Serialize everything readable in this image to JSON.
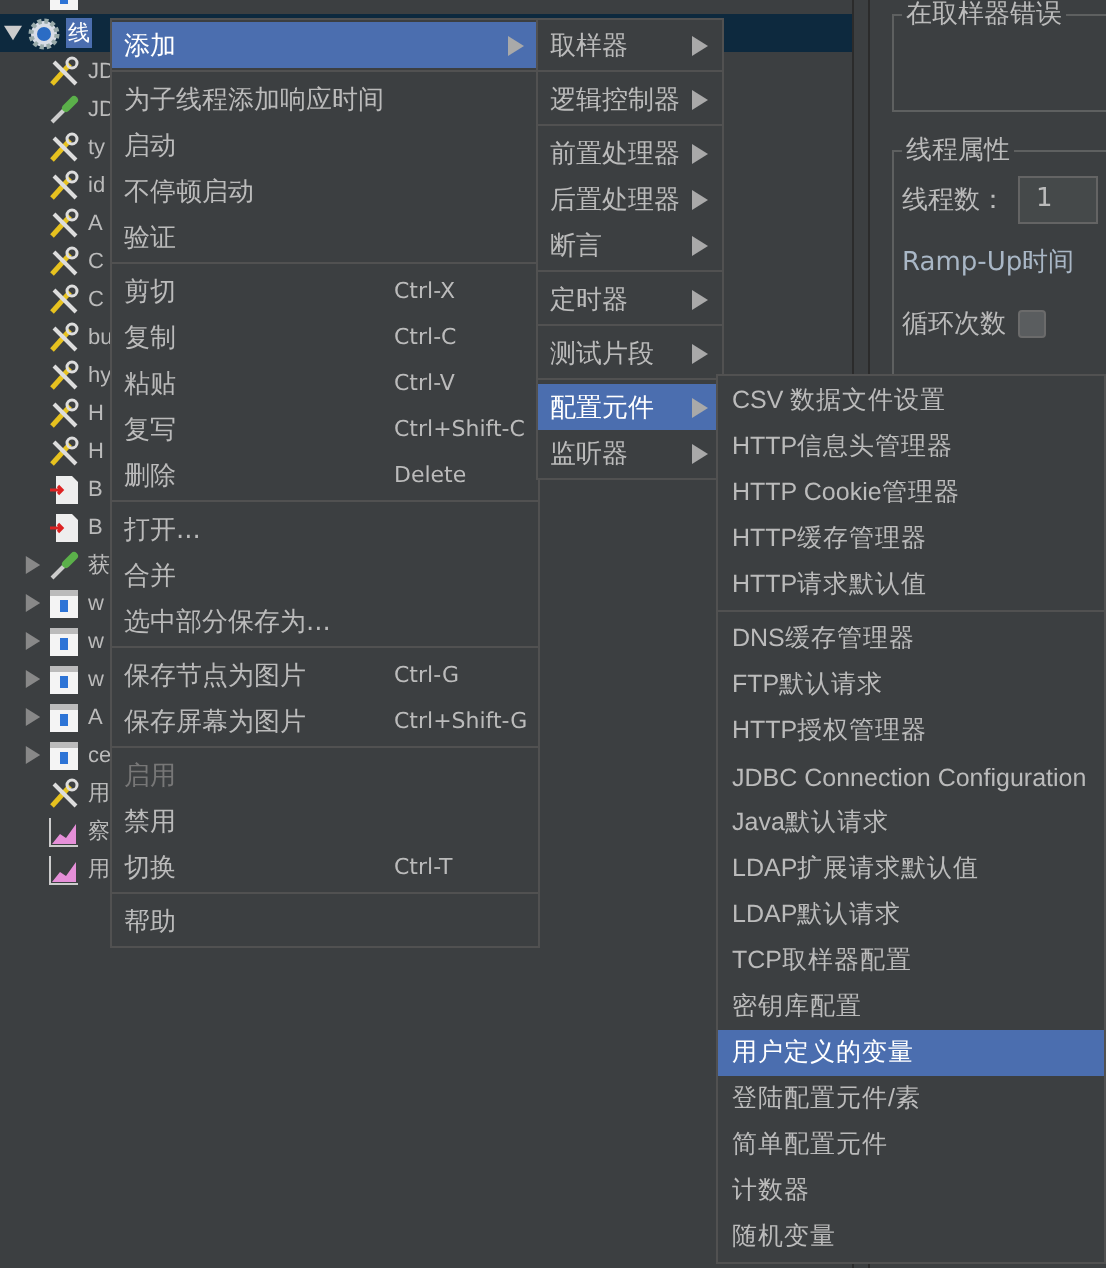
{
  "tree": {
    "items": [
      {
        "label": "线",
        "kind": "thread-group",
        "selected": true,
        "expanded": true,
        "children": [
          {
            "label": "JD",
            "kind": "wrench",
            "selected": false
          },
          {
            "label": "JD",
            "kind": "dropper",
            "selected": false
          },
          {
            "label": "ty",
            "kind": "wrench",
            "selected": false
          },
          {
            "label": "id",
            "kind": "wrench",
            "selected": false
          },
          {
            "label": "A",
            "kind": "wrench",
            "selected": false
          },
          {
            "label": "C",
            "kind": "wrench",
            "selected": false
          },
          {
            "label": "C",
            "kind": "wrench",
            "selected": false
          },
          {
            "label": "bu",
            "kind": "wrench",
            "selected": false
          },
          {
            "label": "hy",
            "kind": "wrench",
            "selected": false
          },
          {
            "label": "H",
            "kind": "wrench",
            "selected": false
          },
          {
            "label": "H",
            "kind": "wrench",
            "selected": false
          },
          {
            "label": "B",
            "kind": "document",
            "selected": false
          },
          {
            "label": "B",
            "kind": "document",
            "selected": false
          },
          {
            "label": "获",
            "kind": "dropper",
            "selected": false,
            "expanded": false
          },
          {
            "label": "w",
            "kind": "script",
            "selected": false,
            "expanded": false
          },
          {
            "label": "w",
            "kind": "script",
            "selected": false,
            "expanded": false
          },
          {
            "label": "w",
            "kind": "script",
            "selected": false,
            "expanded": false
          },
          {
            "label": "A",
            "kind": "script",
            "selected": false,
            "expanded": false
          },
          {
            "label": "ce",
            "kind": "script",
            "selected": false,
            "expanded": false
          },
          {
            "label": "用",
            "kind": "wrench",
            "selected": false
          },
          {
            "label": "察",
            "kind": "chart",
            "selected": false
          },
          {
            "label": "用",
            "kind": "chart",
            "selected": false
          }
        ]
      }
    ]
  },
  "context_menu": {
    "items": [
      {
        "kind": "item",
        "label": "添加",
        "selected": true,
        "submenu": true
      },
      {
        "kind": "separator"
      },
      {
        "kind": "item",
        "label": "为子线程添加响应时间",
        "selected": false
      },
      {
        "kind": "item",
        "label": "启动",
        "selected": false
      },
      {
        "kind": "item",
        "label": "不停顿启动",
        "selected": false
      },
      {
        "kind": "item",
        "label": "验证",
        "selected": false
      },
      {
        "kind": "separator"
      },
      {
        "kind": "item",
        "label": "剪切",
        "shortcut": "Ctrl-X",
        "selected": false
      },
      {
        "kind": "item",
        "label": "复制",
        "shortcut": "Ctrl-C",
        "selected": false
      },
      {
        "kind": "item",
        "label": "粘贴",
        "shortcut": "Ctrl-V",
        "selected": false
      },
      {
        "kind": "item",
        "label": "复写",
        "shortcut": "Ctrl+Shift-C",
        "selected": false
      },
      {
        "kind": "item",
        "label": "删除",
        "shortcut": "Delete",
        "selected": false
      },
      {
        "kind": "separator"
      },
      {
        "kind": "item",
        "label": "打开...",
        "selected": false
      },
      {
        "kind": "item",
        "label": "合并",
        "selected": false
      },
      {
        "kind": "item",
        "label": "选中部分保存为...",
        "selected": false
      },
      {
        "kind": "separator"
      },
      {
        "kind": "item",
        "label": "保存节点为图片",
        "shortcut": "Ctrl-G",
        "selected": false
      },
      {
        "kind": "item",
        "label": "保存屏幕为图片",
        "shortcut": "Ctrl+Shift-G",
        "selected": false
      },
      {
        "kind": "separator"
      },
      {
        "kind": "item",
        "label": "启用",
        "selected": false,
        "disabled": true
      },
      {
        "kind": "item",
        "label": "禁用",
        "selected": false
      },
      {
        "kind": "item",
        "label": "切换",
        "shortcut": "Ctrl-T",
        "selected": false
      },
      {
        "kind": "separator"
      },
      {
        "kind": "item",
        "label": "帮助",
        "selected": false
      }
    ]
  },
  "add_submenu": {
    "items": [
      {
        "kind": "item",
        "label": "取样器",
        "selected": false,
        "submenu": true
      },
      {
        "kind": "separator"
      },
      {
        "kind": "item",
        "label": "逻辑控制器",
        "selected": false,
        "submenu": true
      },
      {
        "kind": "separator"
      },
      {
        "kind": "item",
        "label": "前置处理器",
        "selected": false,
        "submenu": true
      },
      {
        "kind": "item",
        "label": "后置处理器",
        "selected": false,
        "submenu": true
      },
      {
        "kind": "item",
        "label": "断言",
        "selected": false,
        "submenu": true
      },
      {
        "kind": "separator"
      },
      {
        "kind": "item",
        "label": "定时器",
        "selected": false,
        "submenu": true
      },
      {
        "kind": "separator"
      },
      {
        "kind": "item",
        "label": "测试片段",
        "selected": false,
        "submenu": true
      },
      {
        "kind": "separator"
      },
      {
        "kind": "item",
        "label": "配置元件",
        "selected": true,
        "submenu": true
      },
      {
        "kind": "item",
        "label": "监听器",
        "selected": false,
        "submenu": true
      }
    ]
  },
  "config_submenu": {
    "items": [
      {
        "kind": "item",
        "label": "CSV 数据文件设置",
        "selected": false
      },
      {
        "kind": "item",
        "label": "HTTP信息头管理器",
        "selected": false
      },
      {
        "kind": "item",
        "label": "HTTP Cookie管理器",
        "selected": false
      },
      {
        "kind": "item",
        "label": "HTTP缓存管理器",
        "selected": false
      },
      {
        "kind": "item",
        "label": "HTTP请求默认值",
        "selected": false
      },
      {
        "kind": "separator"
      },
      {
        "kind": "item",
        "label": "DNS缓存管理器",
        "selected": false
      },
      {
        "kind": "item",
        "label": "FTP默认请求",
        "selected": false
      },
      {
        "kind": "item",
        "label": "HTTP授权管理器",
        "selected": false
      },
      {
        "kind": "item",
        "label": "JDBC Connection Configuration",
        "selected": false
      },
      {
        "kind": "item",
        "label": "Java默认请求",
        "selected": false
      },
      {
        "kind": "item",
        "label": "LDAP扩展请求默认值",
        "selected": false
      },
      {
        "kind": "item",
        "label": "LDAP默认请求",
        "selected": false
      },
      {
        "kind": "item",
        "label": "TCP取样器配置",
        "selected": false
      },
      {
        "kind": "item",
        "label": "密钥库配置",
        "selected": false
      },
      {
        "kind": "item",
        "label": "用户定义的变量",
        "selected": true
      },
      {
        "kind": "item",
        "label": "登陆配置元件/素",
        "selected": false
      },
      {
        "kind": "item",
        "label": "简单配置元件",
        "selected": false
      },
      {
        "kind": "item",
        "label": "计数器",
        "selected": false
      },
      {
        "kind": "item",
        "label": "随机变量",
        "selected": false
      }
    ]
  },
  "right_panel": {
    "error_group_title": "在取样器错误",
    "thread_properties": {
      "title": "线程属性",
      "thread_count_label": "线程数：",
      "thread_count_value": "1",
      "ramp_up_label": "Ramp-Up时间",
      "loop_count_label": "循环次数",
      "loop_forever_checked": false
    }
  }
}
